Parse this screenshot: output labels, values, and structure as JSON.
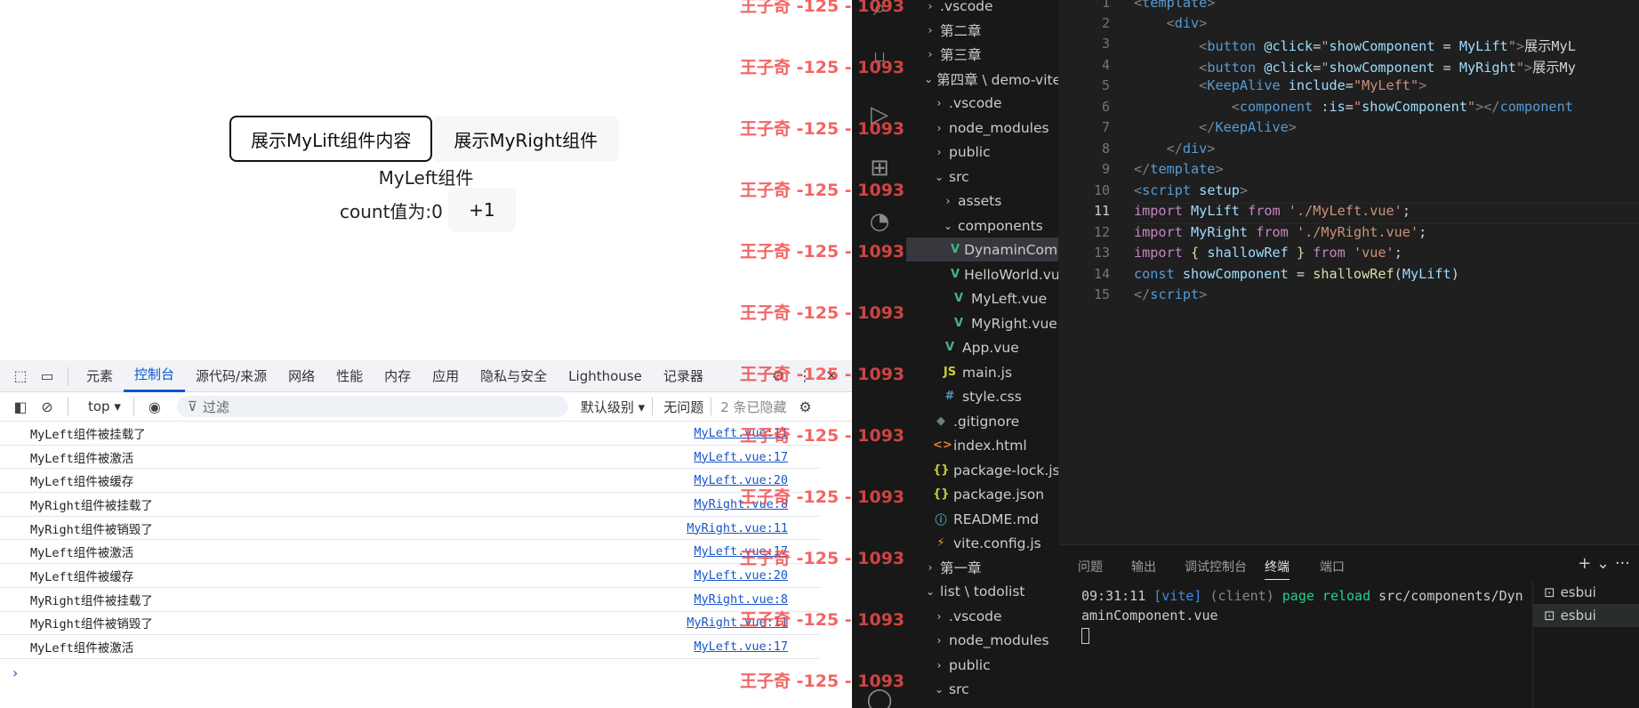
{
  "page": {
    "btn_left": "展示MyLift组件内容",
    "btn_right": "展示MyRight组件",
    "component_name": "MyLeft组件",
    "count_label": "count值为:0",
    "count_button": "+1"
  },
  "devtools": {
    "tabs": [
      "元素",
      "控制台",
      "源代码/来源",
      "网络",
      "性能",
      "内存",
      "应用",
      "隐私与安全",
      "Lighthouse",
      "记录器"
    ],
    "active_tab": "控制台",
    "context": "top ▾",
    "filter_placeholder": "过滤",
    "level": "默认级别 ▾",
    "issues": "无问题",
    "hidden_count": "2 条已隐藏",
    "logs": [
      {
        "msg": "MyLeft组件被挂载了",
        "src": "MyLeft.vue:11"
      },
      {
        "msg": "MyLeft组件被激活",
        "src": "MyLeft.vue:17"
      },
      {
        "msg": "MyLeft组件被缓存",
        "src": "MyLeft.vue:20"
      },
      {
        "msg": "MyRight组件被挂载了",
        "src": "MyRight.vue:8"
      },
      {
        "msg": "MyRight组件被销毁了",
        "src": "MyRight.vue:11"
      },
      {
        "msg": "MyLeft组件被激活",
        "src": "MyLeft.vue:17"
      },
      {
        "msg": "MyLeft组件被缓存",
        "src": "MyLeft.vue:20"
      },
      {
        "msg": "MyRight组件被挂载了",
        "src": "MyRight.vue:8"
      },
      {
        "msg": "MyRight组件被销毁了",
        "src": "MyRight.vue:11"
      },
      {
        "msg": "MyLeft组件被激活",
        "src": "MyLeft.vue:17"
      }
    ],
    "prompt": "›"
  },
  "watermark": "王子奇 -125 - 1093",
  "explorer": {
    "items": [
      {
        "label": ".vscode",
        "chev": "›"
      },
      {
        "label": "第二章",
        "chev": "›"
      },
      {
        "label": "第三章",
        "chev": "›"
      },
      {
        "label": "第四章 \\ demo-vite",
        "chev": "⌄"
      },
      {
        "label": ".vscode",
        "chev": "›"
      },
      {
        "label": "node_modules",
        "chev": "›"
      },
      {
        "label": "public",
        "chev": "›"
      },
      {
        "label": "src",
        "chev": "⌄"
      },
      {
        "label": "assets",
        "chev": "›"
      },
      {
        "label": "components",
        "chev": "⌄"
      },
      {
        "label": "DynaminCompon...",
        "icon": "V"
      },
      {
        "label": "HelloWorld.vue",
        "icon": "V"
      },
      {
        "label": "MyLeft.vue",
        "icon": "V"
      },
      {
        "label": "MyRight.vue",
        "icon": "V"
      },
      {
        "label": "App.vue",
        "icon": "V"
      },
      {
        "label": "main.js",
        "icon": "JS"
      },
      {
        "label": "style.css",
        "icon": "#"
      },
      {
        "label": ".gitignore",
        "icon": "◆"
      },
      {
        "label": "index.html",
        "icon": "<>"
      },
      {
        "label": "package-lock.json",
        "icon": "{}"
      },
      {
        "label": "package.json",
        "icon": "{}"
      },
      {
        "label": "README.md",
        "icon": "ⓘ"
      },
      {
        "label": "vite.config.js",
        "icon": "⚡"
      },
      {
        "label": "第一章",
        "chev": "›"
      },
      {
        "label": "list \\ todolist",
        "chev": "⌄"
      },
      {
        "label": ".vscode",
        "chev": "›"
      },
      {
        "label": "node_modules",
        "chev": "›"
      },
      {
        "label": "public",
        "chev": "›"
      },
      {
        "label": "src",
        "chev": "⌄"
      }
    ]
  },
  "editor": {
    "line_numbers": [
      "1",
      "2",
      "3",
      "4",
      "5",
      "6",
      "7",
      "8",
      "9",
      "10",
      "11",
      "12",
      "13",
      "14",
      "15"
    ],
    "current_line": "11"
  },
  "panel": {
    "tabs": [
      "问题",
      "输出",
      "调试控制台",
      "终端",
      "端口"
    ],
    "active_tab": "终端",
    "term_time": "09:31:11",
    "term_vite": "[vite]",
    "term_client": "(client)",
    "term_reload": "page reload",
    "term_path": "src/components/Dyn",
    "term_path2": "aminComponent.vue",
    "terminals": [
      "esbui",
      "esbui"
    ],
    "actions": "+ ⌄ ···"
  }
}
